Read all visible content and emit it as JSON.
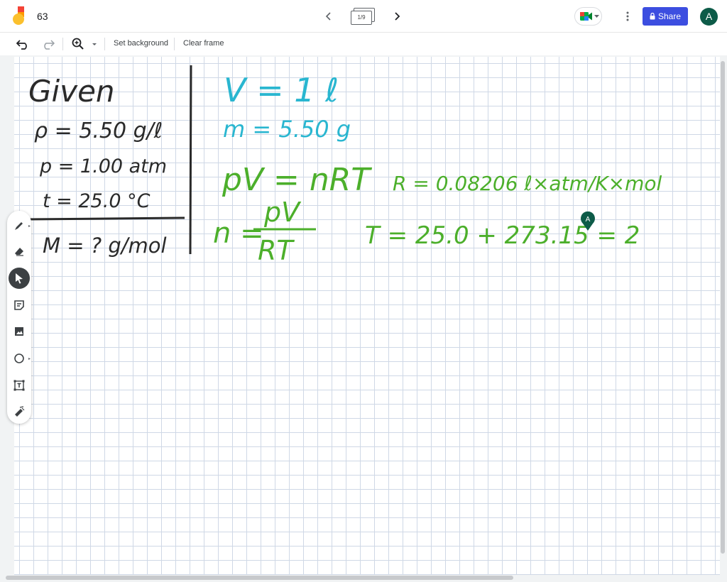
{
  "app": {
    "doc_title": "63",
    "frame_counter": "1/9",
    "share_label": "Share",
    "account_initial": "A",
    "accent_color": "#3c4ee0",
    "avatar_color": "#0d5b48"
  },
  "toolbar": {
    "set_background": "Set background",
    "clear_frame": "Clear frame"
  },
  "tools": [
    "pen-icon",
    "eraser-icon",
    "select-icon",
    "sticky-note-icon",
    "image-icon",
    "circle-icon",
    "text-box-icon",
    "laser-icon"
  ],
  "collaborator": {
    "initial": "A"
  },
  "board": {
    "colors": {
      "black": "#2a2a2a",
      "blue": "#29b6d0",
      "green": "#4caf2b"
    },
    "given": {
      "heading": "Given",
      "rho": "ρ = 5.50 g/ℓ",
      "p": "p = 1.00 atm",
      "t": "t = 25.0 °C",
      "M": "M = ? g/mol"
    },
    "right": {
      "V": "V = 1 ℓ",
      "m": "m = 5.50 g",
      "ideal_gas": "pV = nRT",
      "R": "R = 0.08206 ℓ×atm/K×mol",
      "n_lhs": "n =",
      "n_num": "pV",
      "n_den": "RT",
      "T": "T = 25.0 + 273.15 = 2"
    }
  }
}
